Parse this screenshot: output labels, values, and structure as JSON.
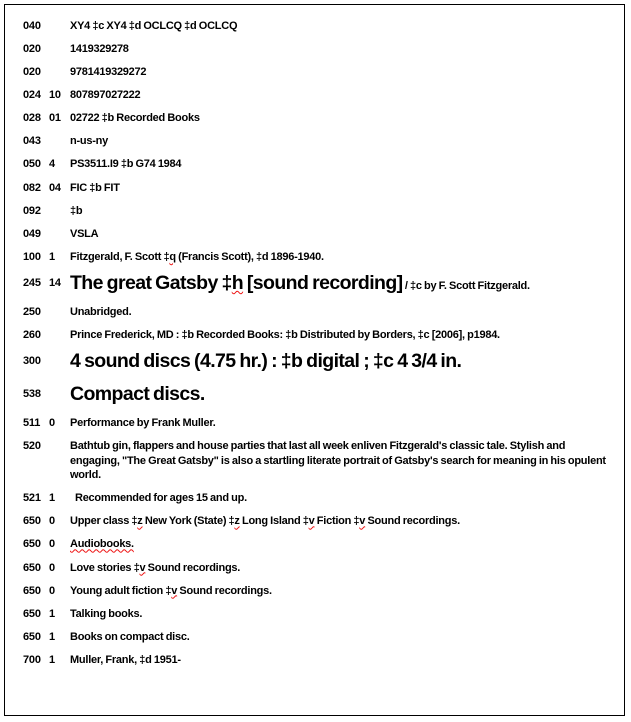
{
  "document": {
    "type": "MARC bibliographic record",
    "border_color": "#000000",
    "background_color": "#ffffff",
    "text_color": "#000000",
    "spellcheck_underline_color": "#ee1111"
  },
  "fields": [
    {
      "tag": "040",
      "ind": "",
      "content": "XY4 ‡c XY4 ‡d OCLCQ ‡d OCLCQ",
      "style": "normal"
    },
    {
      "tag": "020",
      "ind": "",
      "content": "1419329278",
      "style": "normal"
    },
    {
      "tag": "020",
      "ind": "",
      "content": "9781419329272",
      "style": "normal"
    },
    {
      "tag": "024",
      "ind": "10",
      "content": "807897027222",
      "style": "normal"
    },
    {
      "tag": "028",
      "ind": "01",
      "content": "02722 ‡b Recorded Books",
      "style": "normal"
    },
    {
      "tag": "043",
      "ind": "",
      "content": "n-us-ny",
      "style": "normal"
    },
    {
      "tag": "050",
      "ind": "4",
      "content": "PS3511.I9 ‡b G74 1984",
      "style": "normal"
    },
    {
      "tag": "082",
      "ind": "04",
      "content": "FIC ‡b FIT",
      "style": "normal"
    },
    {
      "tag": "092",
      "ind": "",
      "content": "‡b",
      "style": "normal"
    },
    {
      "tag": "049",
      "ind": "",
      "content": "VSLA",
      "style": "normal"
    },
    {
      "tag": "100",
      "ind": "1",
      "content": "Fitzgerald, F. Scott ‡q (Francis Scott), ‡d 1896-1940.",
      "style": "normal"
    },
    {
      "tag": "245",
      "ind": "14",
      "content": "The great Gatsby ‡h [sound recording]",
      "content_tail": " / ‡c by F. Scott Fitzgerald.",
      "style": "big"
    },
    {
      "tag": "250",
      "ind": "",
      "content": "Unabridged.",
      "style": "normal"
    },
    {
      "tag": "260",
      "ind": "",
      "content": "Prince Frederick, MD : ‡b Recorded Books: ‡b Distributed by Borders, ‡c [2006], p1984.",
      "style": "normal"
    },
    {
      "tag": "300",
      "ind": "",
      "content": "4 sound discs (4.75 hr.) : ‡b digital ; ‡c 4 3/4 in.",
      "style": "big"
    },
    {
      "tag": "538",
      "ind": "",
      "content": "Compact discs.",
      "style": "big"
    },
    {
      "tag": "511",
      "ind": "0",
      "content": "Performance by Frank Muller.",
      "style": "normal"
    },
    {
      "tag": "520",
      "ind": "",
      "content": "Bathtub gin, flappers and house parties that last all week enliven Fitzgerald's classic tale. Stylish and engaging, \"The Great Gatsby\" is also a startling literate portrait of Gatsby's search for meaning in his opulent world.",
      "style": "wrap"
    },
    {
      "tag": "521",
      "ind": "1",
      "content": "Recommended for ages 15 and up.",
      "style": "indent"
    },
    {
      "tag": "650",
      "ind": "0",
      "content": "Upper class ‡z New York (State) ‡z Long Island ‡v Fiction ‡v Sound recordings.",
      "style": "normal"
    },
    {
      "tag": "650",
      "ind": "0",
      "content": "Audiobooks.",
      "style": "normal"
    },
    {
      "tag": "650",
      "ind": "0",
      "content": "Love stories ‡v Sound recordings.",
      "style": "normal"
    },
    {
      "tag": "650",
      "ind": "0",
      "content": "Young adult fiction ‡v Sound recordings.",
      "style": "normal"
    },
    {
      "tag": "650",
      "ind": "1",
      "content": "Talking books.",
      "style": "normal"
    },
    {
      "tag": "650",
      "ind": "1",
      "content": "Books on compact disc.",
      "style": "normal"
    },
    {
      "tag": "700",
      "ind": "1",
      "content": "Muller, Frank, ‡d 1951-",
      "style": "normal"
    }
  ],
  "spellcheck_words": [
    "ny",
    "q",
    "h",
    "z",
    "z",
    "v",
    "v",
    "Audiobooks",
    "v",
    "v"
  ]
}
